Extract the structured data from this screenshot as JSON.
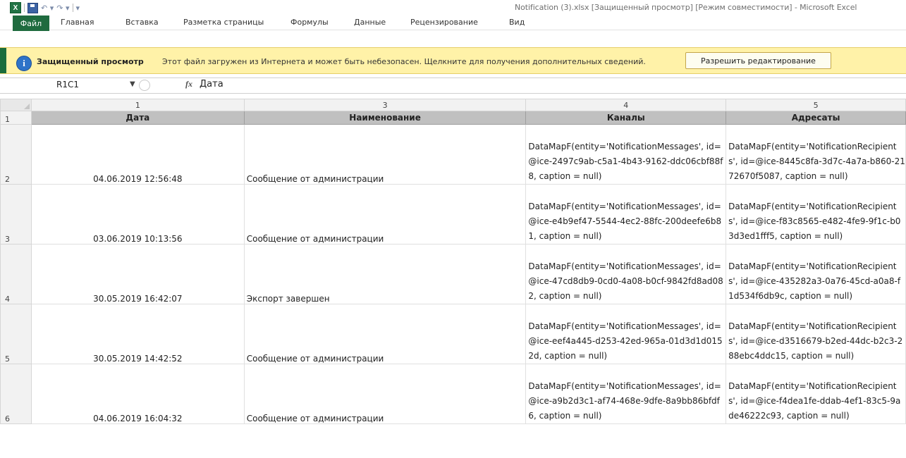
{
  "window": {
    "title": "Notification (3).xlsx  [Защищенный просмотр]  [Режим совместимости]  -  Microsoft Excel"
  },
  "qat": {
    "app_icon": "excel-icon",
    "undo_glyph": "↶ ▾",
    "redo_glyph": "↷ ▾",
    "customize_glyph": "▾"
  },
  "ribbon": {
    "tabs": [
      "Файл",
      "Главная",
      "Вставка",
      "Разметка страницы",
      "Формулы",
      "Данные",
      "Рецензирование",
      "Вид"
    ]
  },
  "protected_view": {
    "title": "Защищенный просмотр",
    "message": "Этот файл загружен из Интернета и может быть небезопасен. Щелкните для получения дополнительных сведений.",
    "button_label": "Разрешить редактирование",
    "icon": "info-icon"
  },
  "formula_bar": {
    "name_box": "R1C1",
    "fx_label": "fx",
    "value": "Дата"
  },
  "sheet": {
    "column_headers": [
      "1",
      "3",
      "4",
      "5"
    ],
    "header_row": {
      "row_number": "1",
      "cells": [
        "Дата",
        "Наименование",
        "Каналы",
        "Адресаты"
      ]
    },
    "rows": [
      {
        "row_number": "2",
        "date": "04.06.2019 12:56:48",
        "name": "Сообщение от администрации",
        "channels": "DataMapF(entity='NotificationMessages', id=@ice-2497c9ab-c5a1-4b43-9162-ddc06cbf88f8, caption = null)",
        "recipients": "DataMapF(entity='NotificationRecipients', id=@ice-8445c8fa-3d7c-4a7a-b860-2172670f5087, caption = null)"
      },
      {
        "row_number": "3",
        "date": "03.06.2019 10:13:56",
        "name": "Сообщение от администрации",
        "channels": "DataMapF(entity='NotificationMessages', id=@ice-e4b9ef47-5544-4ec2-88fc-200deefe6b81, caption = null)",
        "recipients": "DataMapF(entity='NotificationRecipients', id=@ice-f83c8565-e482-4fe9-9f1c-b03d3ed1fff5, caption = null)"
      },
      {
        "row_number": "4",
        "date": "30.05.2019 16:42:07",
        "name": "Экспорт завершен",
        "channels": "DataMapF(entity='NotificationMessages', id=@ice-47cd8db9-0cd0-4a08-b0cf-9842fd8ad082, caption = null)",
        "recipients": "DataMapF(entity='NotificationRecipients', id=@ice-435282a3-0a76-45cd-a0a8-f1d534f6db9c, caption = null)"
      },
      {
        "row_number": "5",
        "date": "30.05.2019 14:42:52",
        "name": "Сообщение от администрации",
        "channels": "DataMapF(entity='NotificationMessages', id=@ice-eef4a445-d253-42ed-965a-01d3d1d0152d, caption = null)",
        "recipients": "DataMapF(entity='NotificationRecipients', id=@ice-d3516679-b2ed-44dc-b2c3-288ebc4ddc15, caption = null)"
      },
      {
        "row_number": "6",
        "date": "04.06.2019 16:04:32",
        "name": "Сообщение от администрации",
        "channels": "DataMapF(entity='NotificationMessages', id=@ice-a9b2d3c1-af74-468e-9dfe-8a9bb86bfdf6, caption = null)",
        "recipients": "DataMapF(entity='NotificationRecipients', id=@ice-f4dea1fe-ddab-4ef1-83c5-9ade46222c93, caption = null)"
      }
    ]
  },
  "colors": {
    "excel_green": "#1f6b3f",
    "protected_bar": "#fff2a8",
    "header_gray": "#c0c0c0"
  }
}
